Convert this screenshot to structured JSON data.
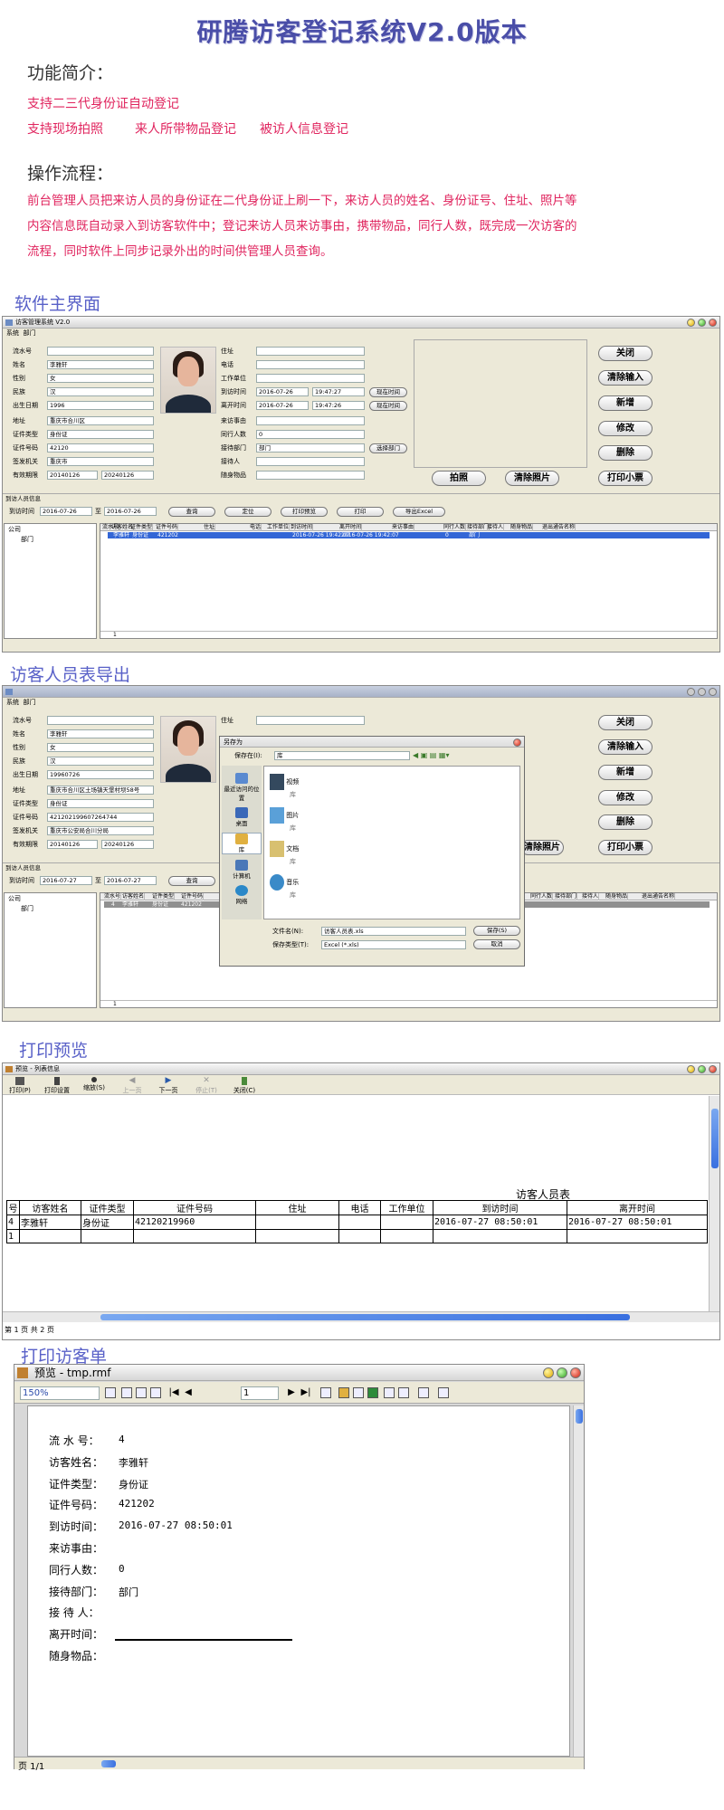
{
  "page": {
    "title": "研腾访客登记系统V2.0版本",
    "intro_heading": "功能简介：",
    "features_line1": "支持二三代身份证自动登记",
    "features_line2": [
      "支持现场拍照",
      "来人所带物品登记",
      "被访人信息登记"
    ],
    "flow_heading": "操作流程：",
    "flow_lines": [
      "前台管理人员把来访人员的身份证在二代身份证上刷一下，来访人员的姓名、身份证号、住址、照片等",
      "内容信息既自动录入到访客软件中；登记来访人员来访事由，携带物品，同行人数，既完成一次访客的",
      "流程，同时软件上同步记录外出的时间供管理人员查询。"
    ],
    "sections": [
      "软件主界面",
      "访客人员表导出",
      "打印预览",
      "打印访客单"
    ]
  },
  "main_window": {
    "title": "访客管理系统 V2.0",
    "menu": [
      "系统",
      "部门"
    ],
    "left_labels": [
      "流水号",
      "姓名",
      "性别",
      "民族",
      "出生日期",
      "地址",
      "证件类型",
      "证件号码",
      "签发机关",
      "有效期限"
    ],
    "left_values": [
      "",
      "李雅轩",
      "女",
      "汉",
      "1996",
      "重庆市合川区",
      "身份证",
      "42120",
      "重庆市",
      ""
    ],
    "valid_from": "20140126",
    "valid_to": "20240126",
    "right_labels": [
      "住址",
      "电话",
      "工作单位",
      "到访时间",
      "离开时间",
      "来访事由",
      "同行人数",
      "接待部门",
      "接待人",
      "随身物品"
    ],
    "visit_date": "2016-07-26",
    "visit_time": "19:47:27",
    "leave_date": "2016-07-26",
    "leave_time": "19:47:26",
    "companions": "0",
    "department": "部门",
    "now_button": "现在时间",
    "choose_dept_button": "选择部门",
    "photo_button": "拍照",
    "clear_photo_button": "清除照片",
    "side_buttons": [
      "关闭",
      "清除输入",
      "新增",
      "修改",
      "删除"
    ],
    "print_ticket_button": "打印小票",
    "info_bar": "到访人员信息",
    "filter_label": "到访时间",
    "filter_from": "2016-07-26",
    "filter_to_label": "至",
    "filter_to": "2016-07-26",
    "filter_buttons": [
      "查询",
      "定位",
      "打印预览",
      "打印",
      "导出Excel"
    ],
    "tree_root": "公司",
    "tree_child": "部门",
    "grid_headers": [
      "流水号",
      "访客姓名",
      "证件类型",
      "证件号码",
      "住址",
      "电话",
      "工作单位",
      "到访时间",
      "离开时间",
      "来访事由",
      "同行人数",
      "接待部门",
      "接待人",
      "随身物品",
      "退出通告名称"
    ],
    "grid_row": [
      "3",
      "李雅轩",
      "身份证",
      "421202",
      "",
      "",
      "",
      "2016-07-26 19:42:07",
      "2016-07-26 19:42:07",
      "",
      "0",
      "部门",
      "",
      "",
      ""
    ],
    "status": "1"
  },
  "export_window": {
    "left_values": [
      "",
      "李雅轩",
      "女",
      "汉",
      "19960726",
      "重庆市合川区土场镇天堡村坝58号",
      "身份证",
      "421202199607264744",
      "重庆市公安局合川分局",
      ""
    ],
    "valid_from": "20140126",
    "valid_to": "20240126",
    "filter_from": "2016-07-27",
    "filter_to": "2016-07-27",
    "grid_row": [
      "4",
      "李雅轩",
      "身份证",
      "421202"
    ],
    "dialog_title": "另存为",
    "save_in_label": "保存在(I):",
    "save_in_value": "库",
    "places": [
      "最近访问的位置",
      "桌面",
      "库",
      "计算机",
      "网络"
    ],
    "files": [
      {
        "name": "视频",
        "sub": "库"
      },
      {
        "name": "图片",
        "sub": "库"
      },
      {
        "name": "文档",
        "sub": "库"
      },
      {
        "name": "音乐",
        "sub": "库"
      }
    ],
    "filename_label": "文件名(N):",
    "filename_value": "访客人员表.xls",
    "filetype_label": "保存类型(T):",
    "filetype_value": "Excel (*.xls)",
    "save_button": "保存(S)",
    "cancel_button": "取消"
  },
  "preview_window": {
    "title": "预览 - 列表信息",
    "toolbar": [
      "打印(P)",
      "打印设置",
      "缩放(S)",
      "上一页",
      "下一页",
      "停止(T)",
      "关闭(C)"
    ],
    "report_title": "访客人员表",
    "headers": [
      "号",
      "访客姓名",
      "证件类型",
      "证件号码",
      "住址",
      "电话",
      "工作单位",
      "到访时间",
      "离开时间"
    ],
    "row1": [
      "4",
      "李雅轩",
      "身份证",
      "42120219960",
      "",
      "",
      "",
      "2016-07-27 08:50:01",
      "2016-07-27 08:50:01"
    ],
    "row2": [
      "1",
      "",
      "",
      "",
      "",
      "",
      "",
      "",
      ""
    ],
    "status": "第 1 页 共 2 页"
  },
  "ticket_window": {
    "title": "预览 - tmp.rmf",
    "zoom": "150%",
    "page_value": "1",
    "labels": [
      "流 水 号：",
      "访客姓名：",
      "证件类型：",
      "证件号码：",
      "到访时间：",
      "来访事由：",
      "同行人数：",
      "接待部门：",
      "接 待 人：",
      "离开时间：",
      "随身物品："
    ],
    "values": [
      "4",
      "李雅轩",
      "身份证",
      "421202",
      "2016-07-27 08:50:01",
      "",
      "0",
      "部门",
      "",
      "",
      ""
    ],
    "status": "页 1/1"
  },
  "colors": {
    "accent_red": "#e0245e",
    "section_blue": "#5961c8",
    "selection": "#3366d6"
  }
}
